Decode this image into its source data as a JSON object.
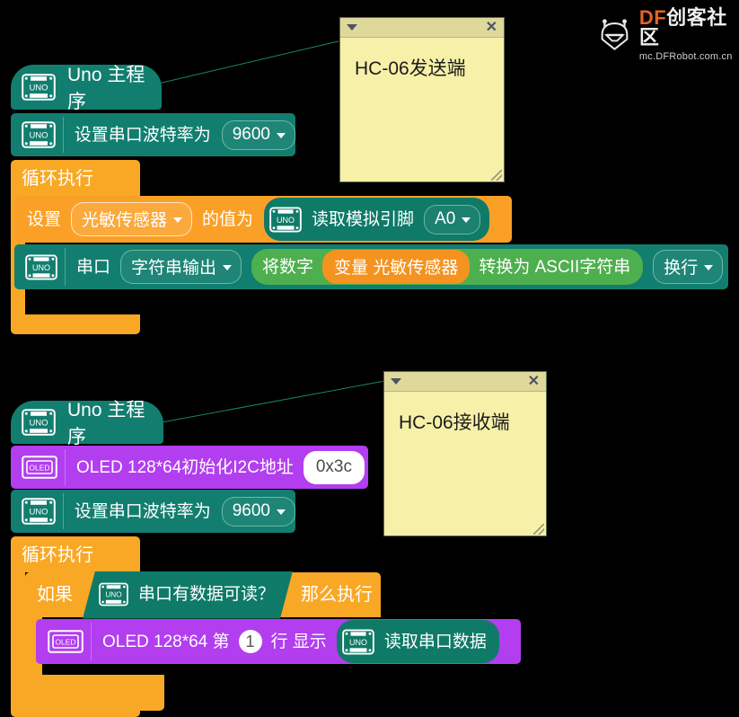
{
  "watermark": {
    "brand_df": "DF",
    "brand_rest": "创客社区",
    "url": "mc.DFRobot.com.cn",
    "logo_icon": "dfrobot-robot-head-icon",
    "accent_color": "#e8641c"
  },
  "palette": {
    "background": "#000000",
    "teal_block": "#127e6f",
    "orange_block": "#f9a825",
    "purple_block": "#b23ef0",
    "light_green_block": "#4eaf4e",
    "note_paper": "#f7f0a8",
    "note_titlebar": "#ded99a",
    "connector_line": "#17856c"
  },
  "notes": [
    {
      "title": "HC-06发送端",
      "collapse_icon": "chevron-down-icon",
      "close_icon": "close-icon",
      "resize_icon": "resize-grip-icon"
    },
    {
      "title": "HC-06接收端",
      "collapse_icon": "chevron-down-icon",
      "close_icon": "close-icon",
      "resize_icon": "resize-grip-icon"
    }
  ],
  "programs": [
    {
      "name": "sender",
      "hat": {
        "icon": "uno-board-icon",
        "label": "Uno 主程序"
      },
      "setup": [
        {
          "icon": "uno-board-icon",
          "label": "设置串口波特率为",
          "field_value": "9600",
          "field_icon": "chevron-down-icon"
        }
      ],
      "loop": {
        "label": "循环执行",
        "statements": [
          {
            "kind": "set-variable",
            "prefix": "设置",
            "variable": "光敏传感器",
            "variable_icon": "chevron-down-icon",
            "middle": "的值为",
            "reporter": {
              "icon": "uno-board-icon",
              "label": "读取模拟引脚",
              "field_value": "A0",
              "field_icon": "chevron-down-icon"
            }
          },
          {
            "kind": "serial-print",
            "icon": "uno-board-icon",
            "label": "串口",
            "mode": "字符串输出",
            "mode_icon": "chevron-down-icon",
            "reporter": {
              "prefix": "将数字",
              "variable": "变量 光敏传感器",
              "suffix": "转换为 ASCII字符串"
            },
            "terminator": "换行",
            "terminator_icon": "chevron-down-icon"
          }
        ]
      }
    },
    {
      "name": "receiver",
      "hat": {
        "icon": "uno-board-icon",
        "label": "Uno 主程序"
      },
      "setup": [
        {
          "icon": "oled-display-icon",
          "label": "OLED 128*64初始化I2C地址",
          "value": "0x3c"
        },
        {
          "icon": "uno-board-icon",
          "label": "设置串口波特率为",
          "field_value": "9600",
          "field_icon": "chevron-down-icon"
        }
      ],
      "loop": {
        "label": "循环执行",
        "statements": [
          {
            "kind": "if-then",
            "if_label": "如果",
            "condition": {
              "icon": "uno-board-icon",
              "label": "串口有数据可读？"
            },
            "then_label": "那么执行",
            "body": [
              {
                "kind": "oled-show",
                "icon": "oled-display-icon",
                "prefix": "OLED 128*64 第",
                "line_number": "1",
                "middle": "行 显示",
                "reporter": {
                  "icon": "uno-board-icon",
                  "label": "读取串口数据"
                }
              }
            ]
          }
        ]
      }
    }
  ]
}
